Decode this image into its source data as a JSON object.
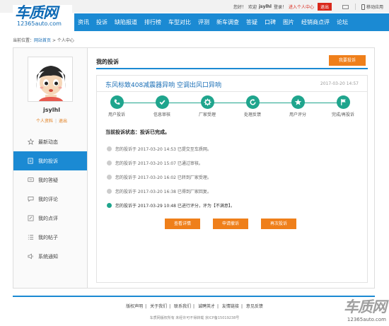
{
  "topbar": {
    "greeting": "您好！",
    "welcome": "欢迎",
    "username": "jsylhl",
    "login_text": "登录！",
    "enter_center": "进入个人中心",
    "logout": "退出",
    "mobile": "移动应用"
  },
  "logo": {
    "main": "车质网",
    "sub": "12365auto.com"
  },
  "nav": [
    "资讯",
    "投诉",
    "缺陷报道",
    "排行榜",
    "车型对比",
    "评测",
    "新车调查",
    "答疑",
    "口碑",
    "图片",
    "经销商点评",
    "论坛"
  ],
  "breadcrumb": {
    "prefix": "当前位置：",
    "home": "网站首页",
    "sep": " > ",
    "current": "个人中心"
  },
  "sidebar": {
    "username": "jsylhl",
    "profile": "个人资料",
    "logout": "退出",
    "items": [
      {
        "label": "最新动态",
        "icon": "star-icon"
      },
      {
        "label": "我的投诉",
        "icon": "edit-icon"
      },
      {
        "label": "我的答疑",
        "icon": "qa-icon"
      },
      {
        "label": "我的评论",
        "icon": "comment-icon"
      },
      {
        "label": "我的点评",
        "icon": "review-icon"
      },
      {
        "label": "我的帖子",
        "icon": "list-icon"
      },
      {
        "label": "系统通知",
        "icon": "speaker-icon"
      }
    ]
  },
  "main": {
    "title": "我的投诉",
    "complain_button": "我要投诉",
    "card": {
      "title": "东风标致408减震器异响 空调出风口异响",
      "date": "2017-03-20 14:57",
      "steps": [
        "用户投诉",
        "信息审核",
        "厂家受理",
        "处理反馈",
        "用户评分",
        "完成/再投诉"
      ],
      "status": "当前投诉状态：投诉已完成。",
      "timeline": [
        "您的投诉于 2017-03-20 14:53 已提交至车质网。",
        "您的投诉于 2017-03-20 15:07 已通过审核。",
        "您的投诉于 2017-03-20 16:02 已转到厂家受理。",
        "您的投诉于 2017-03-20 16:38 已得到厂家回复。",
        "您的投诉于 2017-03-29 10:48 已进行评分，评为【不满意】。"
      ],
      "actions": [
        "查看详情",
        "申请撤诉",
        "再次投诉"
      ]
    }
  },
  "footer": {
    "links": [
      "版权声明",
      "关于我们",
      "联系我们",
      "诚聘英才",
      "友情链接",
      "意见反馈"
    ],
    "copyright": "车质网版权所有 未经许可不得转载  京ICP备15019238号"
  },
  "watermark": {
    "main": "车质网",
    "sub": "12365auto.com"
  },
  "colors": {
    "nav_blue": "#1b8ad3",
    "accent_orange": "#ef7f1a",
    "step_green": "#1fa58d",
    "logo_blue": "#0e6ab5"
  }
}
